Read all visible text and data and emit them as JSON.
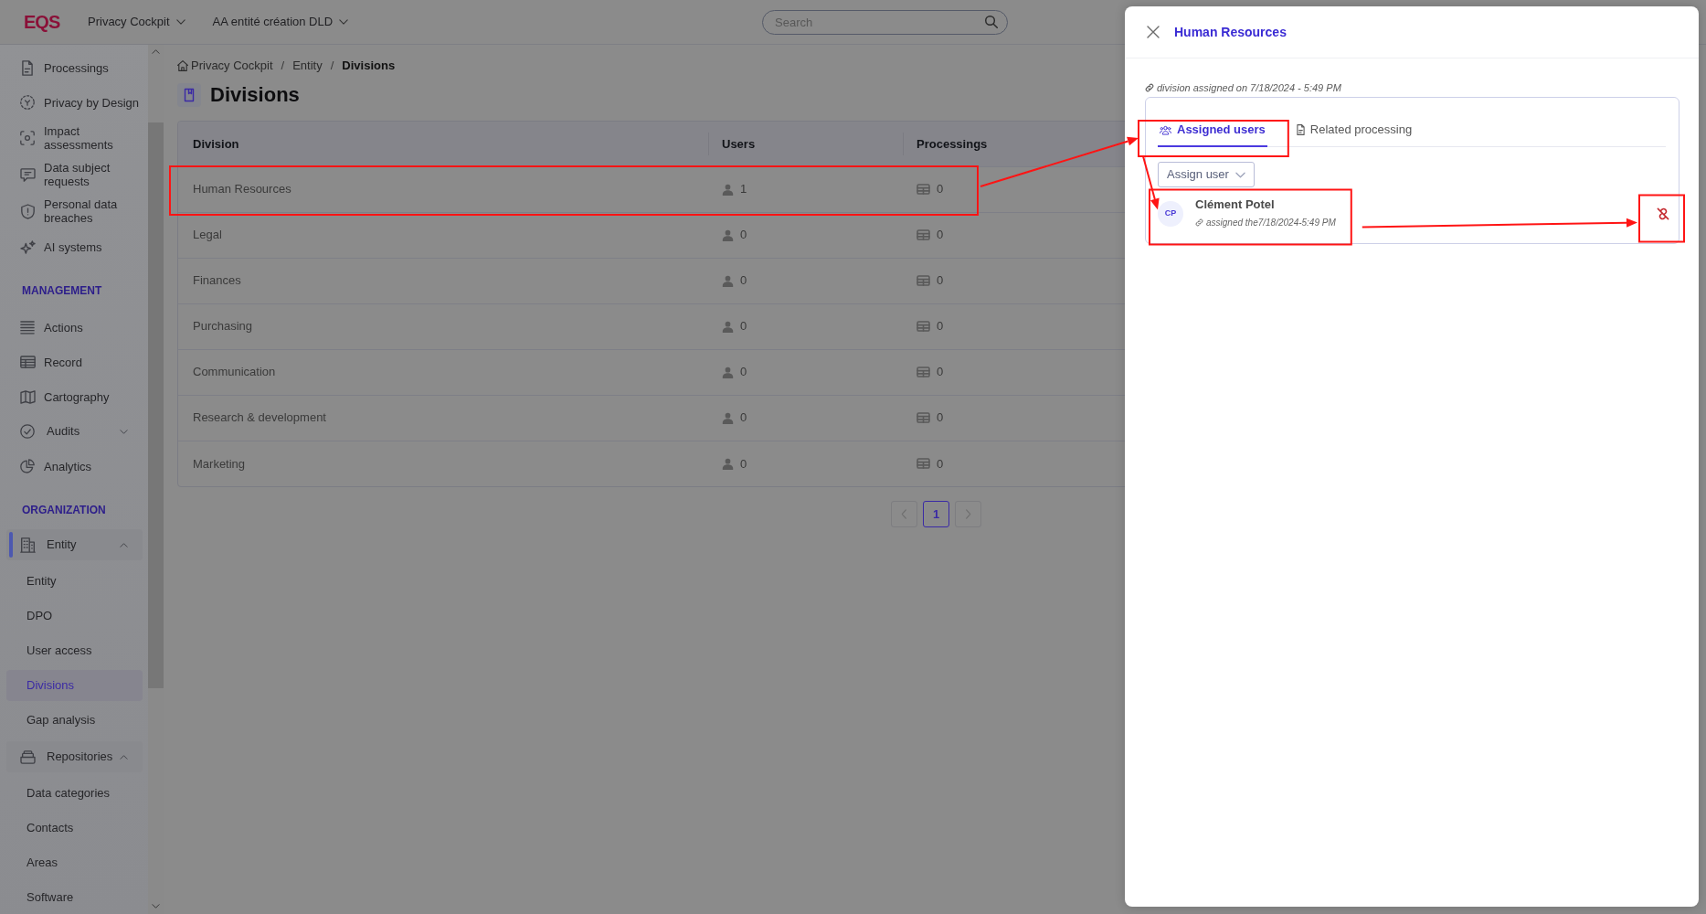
{
  "header": {
    "logo": "EQS",
    "menus": [
      {
        "label": "Privacy Cockpit"
      },
      {
        "label": "AA entité création DLD"
      }
    ],
    "search": {
      "placeholder": "Search"
    }
  },
  "sidebar": {
    "items": [
      {
        "kind": "link",
        "label": "Processings",
        "selected": false
      },
      {
        "kind": "link",
        "label": "Privacy by Design",
        "selected": false
      },
      {
        "kind": "link",
        "label": "Impact assessments",
        "selected": false
      },
      {
        "kind": "link",
        "label": "Data subject requests",
        "selected": false
      },
      {
        "kind": "link",
        "label": "Personal data breaches",
        "selected": false
      },
      {
        "kind": "link",
        "label": "AI systems",
        "selected": false
      },
      {
        "kind": "heading",
        "label": "MANAGEMENT"
      },
      {
        "kind": "link",
        "label": "Actions",
        "selected": false
      },
      {
        "kind": "link",
        "label": "Record",
        "selected": false
      },
      {
        "kind": "link",
        "label": "Cartography",
        "selected": false
      },
      {
        "kind": "group",
        "label": "Audits",
        "expanded": false
      },
      {
        "kind": "link",
        "label": "Analytics",
        "selected": false
      },
      {
        "kind": "heading",
        "label": "ORGANIZATION"
      },
      {
        "kind": "group",
        "label": "Entity",
        "expanded": true,
        "children": [
          {
            "label": "Entity",
            "selected": false
          },
          {
            "label": "DPO",
            "selected": false
          },
          {
            "label": "User access",
            "selected": false
          },
          {
            "label": "Divisions",
            "selected": true
          },
          {
            "label": "Gap analysis",
            "selected": false
          }
        ]
      },
      {
        "kind": "group",
        "label": "Repositories",
        "expanded": true,
        "children": [
          {
            "label": "Data categories",
            "selected": false
          },
          {
            "label": "Contacts",
            "selected": false
          },
          {
            "label": "Areas",
            "selected": false
          },
          {
            "label": "Software",
            "selected": false
          }
        ]
      }
    ]
  },
  "breadcrumb": [
    {
      "kind": "link",
      "label": "Privacy Cockpit"
    },
    {
      "kind": "separator",
      "label": "/"
    },
    {
      "kind": "link",
      "label": "Entity"
    },
    {
      "kind": "separator",
      "label": "/"
    },
    {
      "kind": "current",
      "label": "Divisions"
    }
  ],
  "page_title": "Divisions",
  "table": {
    "columns": [
      "Division",
      "Users",
      "Processings"
    ],
    "rows": [
      {
        "division": "Human Resources",
        "users": "1",
        "processings": "0",
        "highlighted": true
      },
      {
        "division": "Legal",
        "users": "0",
        "processings": "0",
        "highlighted": false
      },
      {
        "division": "Finances",
        "users": "0",
        "processings": "0",
        "highlighted": false
      },
      {
        "division": "Purchasing",
        "users": "0",
        "processings": "0",
        "highlighted": false
      },
      {
        "division": "Communication",
        "users": "0",
        "processings": "0",
        "highlighted": false
      },
      {
        "division": "Research & development",
        "users": "0",
        "processings": "0",
        "highlighted": false
      },
      {
        "division": "Marketing",
        "users": "0",
        "processings": "0",
        "highlighted": false
      }
    ]
  },
  "pagination": {
    "pages": [
      {
        "label": "1",
        "selected": true
      }
    ]
  },
  "drawer": {
    "title": "Human Resources",
    "assignment_note": "division assigned on 7/18/2024 - 5:49 PM",
    "tabs": [
      {
        "label": "Assigned users",
        "selected": true,
        "highlighted": true
      },
      {
        "label": "Related processing",
        "selected": false,
        "highlighted": false
      }
    ],
    "assign_button": "Assign user",
    "users": [
      {
        "initials": "CP",
        "name": "Clément Potel",
        "assigned": "assigned the7/18/2024-5:49 PM",
        "highlighted": true,
        "unlink_highlighted": true
      }
    ]
  }
}
